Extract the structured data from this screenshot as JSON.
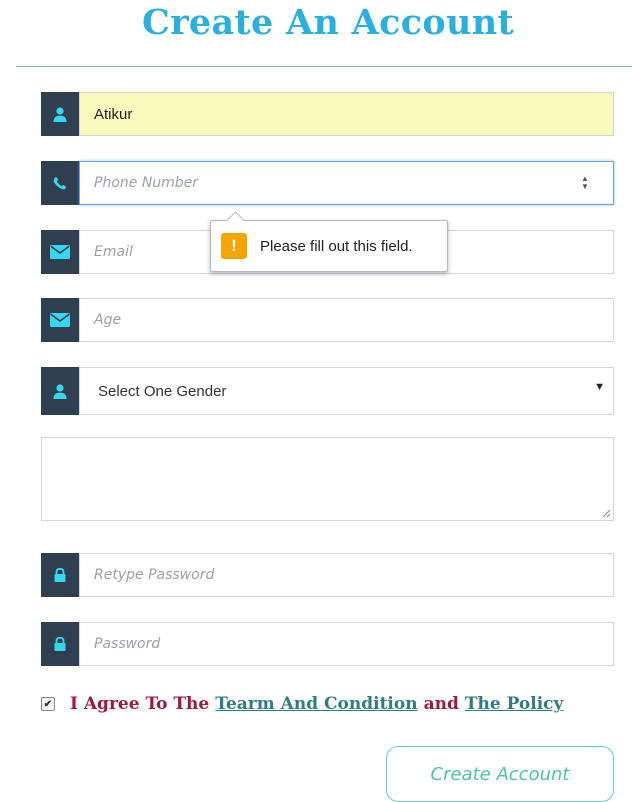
{
  "form": {
    "title": "Create An Account",
    "name_value": "Atikur",
    "phone_placeholder": "Phone Number",
    "email_placeholder": "Email",
    "age_placeholder": "Age",
    "gender_selected": "Select One Gender",
    "retype_password_placeholder": "Retype Password",
    "password_placeholder": "Password",
    "agree_text": "I Agree To The",
    "terms_link": "Tearm And Condition",
    "and_text": "and",
    "policy_link": "The Policy",
    "submit_label": "Create Account"
  },
  "tooltip": {
    "message": "Please fill out this field."
  },
  "colors": {
    "title": "#2ab0df",
    "addon_bg": "#2f3f4f",
    "icon": "#35d8f0",
    "filled_bg": "#fafcbd",
    "agree_text": "#a01840",
    "link": "#2e7d86",
    "submit": "#4fc3a1",
    "warning": "#f5a500"
  },
  "icons": [
    "user-icon",
    "phone-icon",
    "envelope-icon",
    "lock-icon",
    "warning-icon",
    "checkmark-icon"
  ]
}
